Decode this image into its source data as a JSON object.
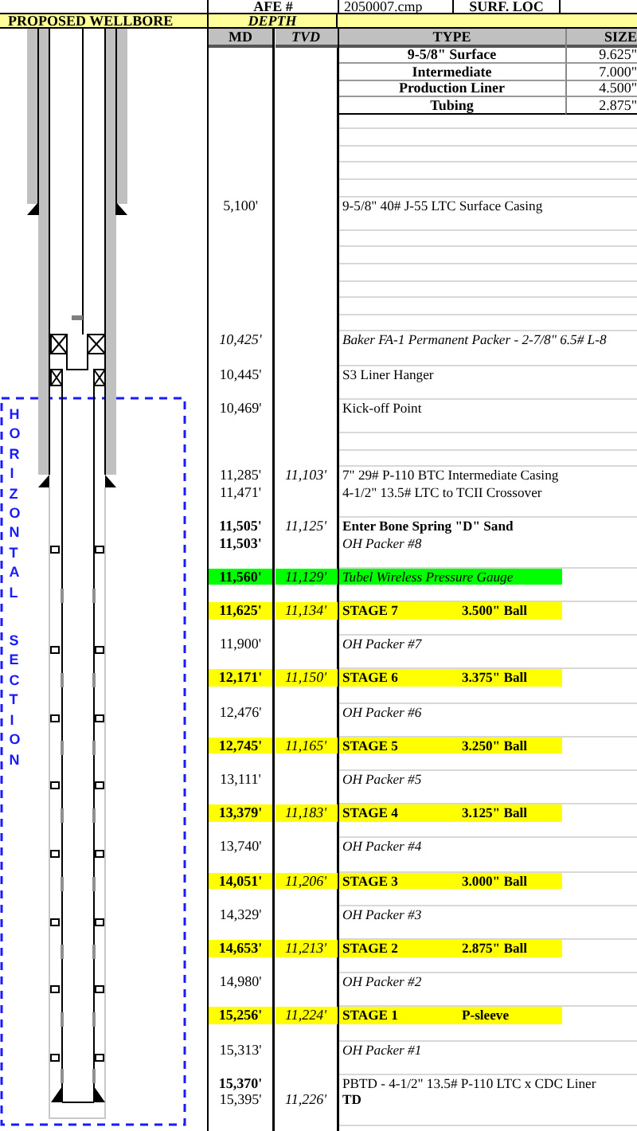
{
  "header": {
    "afe_label": "AFE #",
    "afe_value": "2050007.cmp",
    "location_label": "SURF. LOC"
  },
  "wellbore_title": "PROPOSED WELLBORE",
  "depth_title": "DEPTH",
  "columns": [
    "MD",
    "TVD",
    "TYPE",
    "SIZE"
  ],
  "casings": [
    {
      "type": "9-5/8\" Surface",
      "size": "9.625\""
    },
    {
      "type": "Intermediate",
      "size": "7.000\""
    },
    {
      "type": "Production Liner",
      "size": "4.500\""
    },
    {
      "type": "Tubing",
      "size": "2.875\""
    }
  ],
  "section_label": [
    "HORIZONTAL",
    "SECTION"
  ],
  "rows": [
    {
      "kind": "blank"
    },
    {
      "kind": "blank"
    },
    {
      "kind": "blank"
    },
    {
      "kind": "blank"
    },
    {
      "kind": "blank"
    },
    {
      "kind": "entry",
      "md": "5,100'",
      "md_bold": false,
      "md_italic": false,
      "text": "9-5/8\" 40# J-55 LTC Surface Casing",
      "text_bold": false,
      "text_italic": false
    },
    {
      "kind": "blank"
    },
    {
      "kind": "blank"
    },
    {
      "kind": "blank"
    },
    {
      "kind": "blank"
    },
    {
      "kind": "blank"
    },
    {
      "kind": "blank"
    },
    {
      "kind": "blank"
    },
    {
      "kind": "entry",
      "md": "10,425'",
      "md_bold": false,
      "md_italic": true,
      "text": "Baker FA-1 Permanent Packer - 2-7/8\" 6.5# L-8",
      "text_bold": false,
      "text_italic": true
    },
    {
      "kind": "blank"
    },
    {
      "kind": "entry",
      "md": "10,445'",
      "md_bold": false,
      "md_italic": false,
      "text": "S3 Liner Hanger",
      "text_bold": false,
      "text_italic": false
    },
    {
      "kind": "blank"
    },
    {
      "kind": "entry",
      "md": "10,469'",
      "md_bold": false,
      "md_italic": false,
      "text": "Kick-off Point",
      "text_bold": false,
      "text_italic": false
    },
    {
      "kind": "blank"
    },
    {
      "kind": "blank"
    },
    {
      "kind": "blank"
    },
    {
      "kind": "entry",
      "md": "11,285'",
      "md_bold": false,
      "md_italic": false,
      "tvd": "11,103'",
      "text": "7\" 29# P-110 BTC Intermediate Casing",
      "text_bold": false,
      "text_italic": false
    },
    {
      "kind": "entry",
      "md": "11,471'",
      "md_bold": false,
      "md_italic": false,
      "text": "4-1/2\" 13.5# LTC to TCII Crossover",
      "text_bold": false,
      "text_italic": false
    },
    {
      "kind": "blank"
    },
    {
      "kind": "entry",
      "md": "11,505'",
      "md_bold": true,
      "md_italic": false,
      "tvd": "11,125'",
      "text": "Enter Bone Spring \"D\" Sand",
      "text_bold": true,
      "text_italic": false
    },
    {
      "kind": "entry",
      "md": "11,503'",
      "md_bold": true,
      "md_italic": false,
      "text": "OH Packer #8",
      "text_bold": false,
      "text_italic": true
    },
    {
      "kind": "blank"
    },
    {
      "kind": "entry",
      "md": "11,560'",
      "md_bold": true,
      "md_italic": false,
      "tvd": "11,129'",
      "text": "Tubel Wireless Pressure Gauge",
      "text_bold": false,
      "text_italic": true,
      "color": "#00ff00"
    },
    {
      "kind": "blank"
    },
    {
      "kind": "entry",
      "md": "11,625'",
      "md_bold": true,
      "md_italic": false,
      "tvd": "11,134'",
      "text": "STAGE 7",
      "ball": "3.500\" Ball",
      "text_bold": true,
      "text_italic": false,
      "color": "#ffff00"
    },
    {
      "kind": "blank"
    },
    {
      "kind": "entry",
      "md": "11,900'",
      "md_bold": false,
      "md_italic": false,
      "text": "OH Packer #7",
      "text_bold": false,
      "text_italic": true
    },
    {
      "kind": "blank"
    },
    {
      "kind": "entry",
      "md": "12,171'",
      "md_bold": true,
      "md_italic": false,
      "tvd": "11,150'",
      "text": "STAGE 6",
      "ball": "3.375\" Ball",
      "text_bold": true,
      "text_italic": false,
      "color": "#ffff00"
    },
    {
      "kind": "blank"
    },
    {
      "kind": "entry",
      "md": "12,476'",
      "md_bold": false,
      "md_italic": false,
      "text": "OH Packer #6",
      "text_bold": false,
      "text_italic": true
    },
    {
      "kind": "blank"
    },
    {
      "kind": "entry",
      "md": "12,745'",
      "md_bold": true,
      "md_italic": false,
      "tvd": "11,165'",
      "text": "STAGE 5",
      "ball": "3.250\" Ball",
      "text_bold": true,
      "text_italic": false,
      "color": "#ffff00"
    },
    {
      "kind": "blank"
    },
    {
      "kind": "entry",
      "md": "13,111'",
      "md_bold": false,
      "md_italic": false,
      "text": "OH Packer #5",
      "text_bold": false,
      "text_italic": true
    },
    {
      "kind": "blank"
    },
    {
      "kind": "entry",
      "md": "13,379'",
      "md_bold": true,
      "md_italic": false,
      "tvd": "11,183'",
      "text": "STAGE 4",
      "ball": "3.125\" Ball",
      "text_bold": true,
      "text_italic": false,
      "color": "#ffff00"
    },
    {
      "kind": "blank"
    },
    {
      "kind": "entry",
      "md": "13,740'",
      "md_bold": false,
      "md_italic": false,
      "text": "OH Packer #4",
      "text_bold": false,
      "text_italic": true
    },
    {
      "kind": "blank"
    },
    {
      "kind": "entry",
      "md": "14,051'",
      "md_bold": true,
      "md_italic": false,
      "tvd": "11,206'",
      "text": "STAGE 3",
      "ball": "3.000\" Ball",
      "text_bold": true,
      "text_italic": false,
      "color": "#ffff00"
    },
    {
      "kind": "blank"
    },
    {
      "kind": "entry",
      "md": "14,329'",
      "md_bold": false,
      "md_italic": false,
      "text": "OH Packer #3",
      "text_bold": false,
      "text_italic": true
    },
    {
      "kind": "blank"
    },
    {
      "kind": "entry",
      "md": "14,653'",
      "md_bold": true,
      "md_italic": false,
      "tvd": "11,213'",
      "text": "STAGE 2",
      "ball": "2.875\" Ball",
      "text_bold": true,
      "text_italic": false,
      "color": "#ffff00"
    },
    {
      "kind": "blank"
    },
    {
      "kind": "entry",
      "md": "14,980'",
      "md_bold": false,
      "md_italic": false,
      "text": "OH Packer #2",
      "text_bold": false,
      "text_italic": true
    },
    {
      "kind": "blank"
    },
    {
      "kind": "entry",
      "md": "15,256'",
      "md_bold": true,
      "md_italic": false,
      "tvd": "11,224'",
      "text": "STAGE 1",
      "ball": "P-sleeve",
      "text_bold": true,
      "text_italic": false,
      "color": "#ffff00"
    },
    {
      "kind": "blank"
    },
    {
      "kind": "entry",
      "md": "15,313'",
      "md_bold": false,
      "md_italic": false,
      "text": "OH Packer #1",
      "text_bold": false,
      "text_italic": true
    },
    {
      "kind": "blank"
    },
    {
      "kind": "entry",
      "md": "15,370'",
      "md_bold": true,
      "md_italic": false,
      "text": "PBTD - 4-1/2\" 13.5# P-110 LTC x CDC Liner",
      "text_bold": false,
      "text_italic": false
    },
    {
      "kind": "entry",
      "md": "15,395'",
      "md_bold": false,
      "md_italic": false,
      "tvd": "11,226'",
      "text": "TD",
      "text_bold": true,
      "text_italic": false
    },
    {
      "kind": "blank"
    }
  ]
}
